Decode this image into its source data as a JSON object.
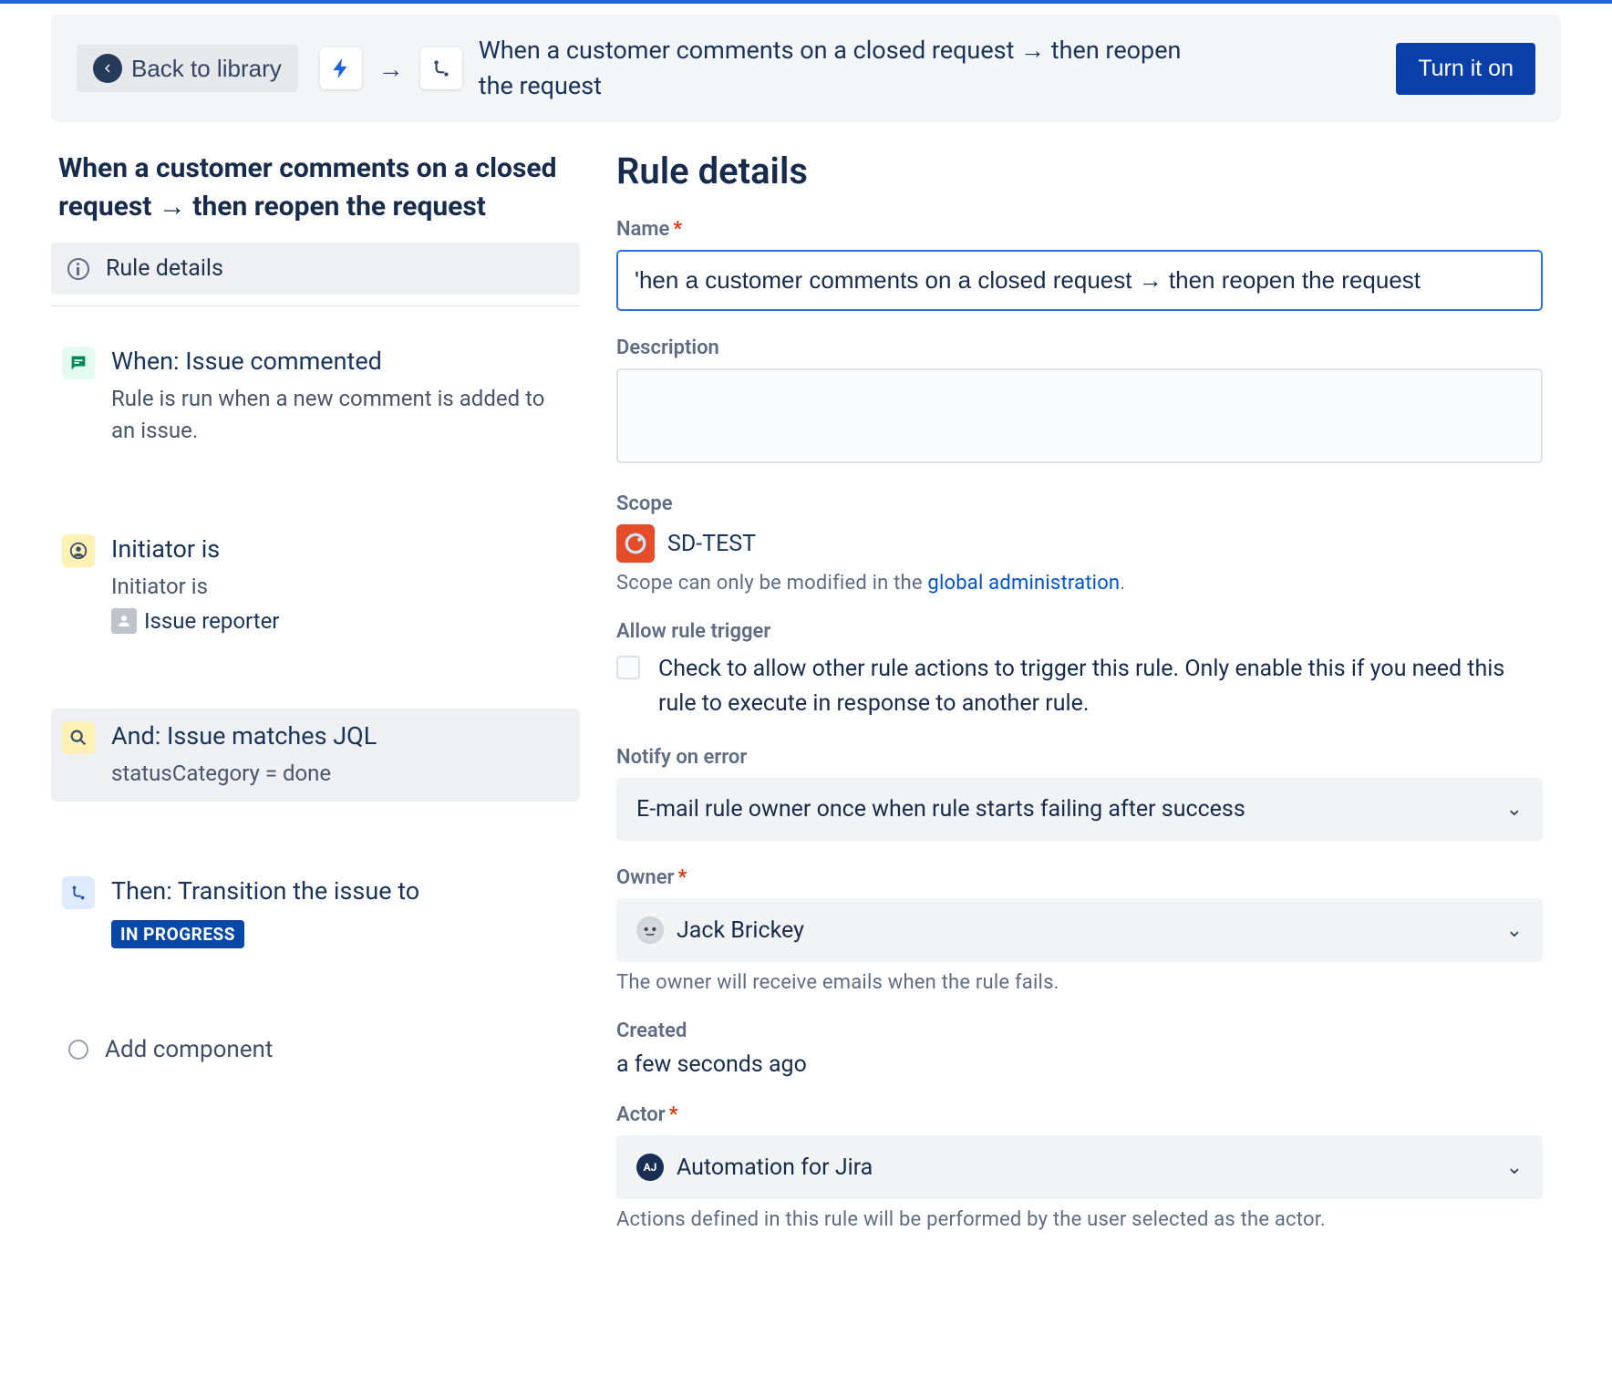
{
  "header": {
    "back_label": "Back to library",
    "summary": "When a customer comments on a closed request → then reopen the request",
    "turn_on_label": "Turn it on"
  },
  "sidebar": {
    "title": "When a customer comments on a closed request → then reopen the request",
    "rule_details_label": "Rule details",
    "steps": {
      "trigger": {
        "heading": "When: Issue commented",
        "sub": "Rule is run when a new comment is added to an issue."
      },
      "cond1": {
        "heading": "Initiator is",
        "sub": "Initiator is",
        "reporter": "Issue reporter"
      },
      "cond2": {
        "heading": "And: Issue matches JQL",
        "sub": "statusCategory = done"
      },
      "action": {
        "heading": "Then: Transition the issue to",
        "status": "IN PROGRESS"
      },
      "add": {
        "heading": "Add component"
      }
    }
  },
  "details": {
    "section_title": "Rule details",
    "name_label": "Name",
    "name_value": "'hen a customer comments on a closed request → then reopen the request",
    "description_label": "Description",
    "description_value": "",
    "scope_label": "Scope",
    "scope_project": "SD-TEST",
    "scope_helper_prefix": "Scope can only be modified in the ",
    "scope_helper_link": "global administration",
    "allow_trigger_label": "Allow rule trigger",
    "allow_trigger_check_text": "Check to allow other rule actions to trigger this rule. Only enable this if you need this rule to execute in response to another rule.",
    "notify_label": "Notify on error",
    "notify_value": "E-mail rule owner once when rule starts failing after success",
    "owner_label": "Owner",
    "owner_value": "Jack Brickey",
    "owner_helper": "The owner will receive emails when the rule fails.",
    "created_label": "Created",
    "created_value": "a few seconds ago",
    "actor_label": "Actor",
    "actor_value": "Automation for Jira",
    "actor_initials": "AJ",
    "actor_helper": "Actions defined in this rule will be performed by the user selected as the actor."
  }
}
